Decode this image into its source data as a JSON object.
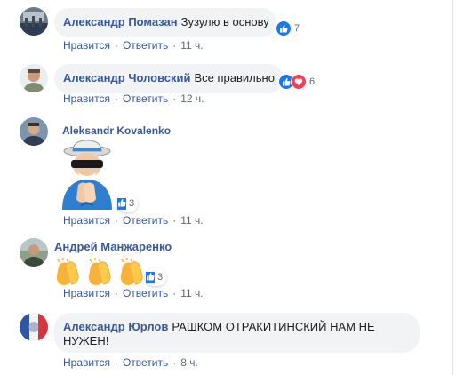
{
  "comments": [
    {
      "author": "Александр Помазан",
      "text": "Зузулю в основу",
      "reactions": {
        "types": [
          "like"
        ],
        "count": "7"
      },
      "actions": {
        "like": "Нравится",
        "reply": "Ответить",
        "time": "11 ч."
      }
    },
    {
      "author": "Александр Чоловский",
      "text": "Все правильно",
      "reactions": {
        "types": [
          "like",
          "love"
        ],
        "count": "6"
      },
      "actions": {
        "like": "Нравится",
        "reply": "Ответить",
        "time": "12 ч."
      }
    },
    {
      "author": "Aleksandr Kovalenko",
      "sticker": "clapping-grandpa-sticker",
      "reactions": {
        "types": [
          "like"
        ],
        "count": "3"
      },
      "actions": {
        "like": "Нравится",
        "reply": "Ответить",
        "time": "11 ч."
      }
    },
    {
      "author": "Андрей Манжаренко",
      "emoji": "👏👏👏",
      "reactions": {
        "types": [
          "like"
        ],
        "count": "3"
      },
      "actions": {
        "like": "Нравится",
        "reply": "Ответить",
        "time": "11 ч."
      }
    },
    {
      "author": "Александр Юрлов",
      "text": "РАШКОМ ОТРАКИТИНСКИЙ НАМ НЕ НУЖЕН!",
      "actions": {
        "like": "Нравится",
        "reply": "Ответить",
        "time": "8 ч."
      }
    }
  ],
  "colors": {
    "link": "#385898",
    "bubble": "#f2f3f5",
    "meta": "#606770",
    "like": "#1877f2",
    "love": "#f33e58"
  },
  "icons": [
    "like-icon",
    "love-icon",
    "clapping-hands-emoji"
  ]
}
